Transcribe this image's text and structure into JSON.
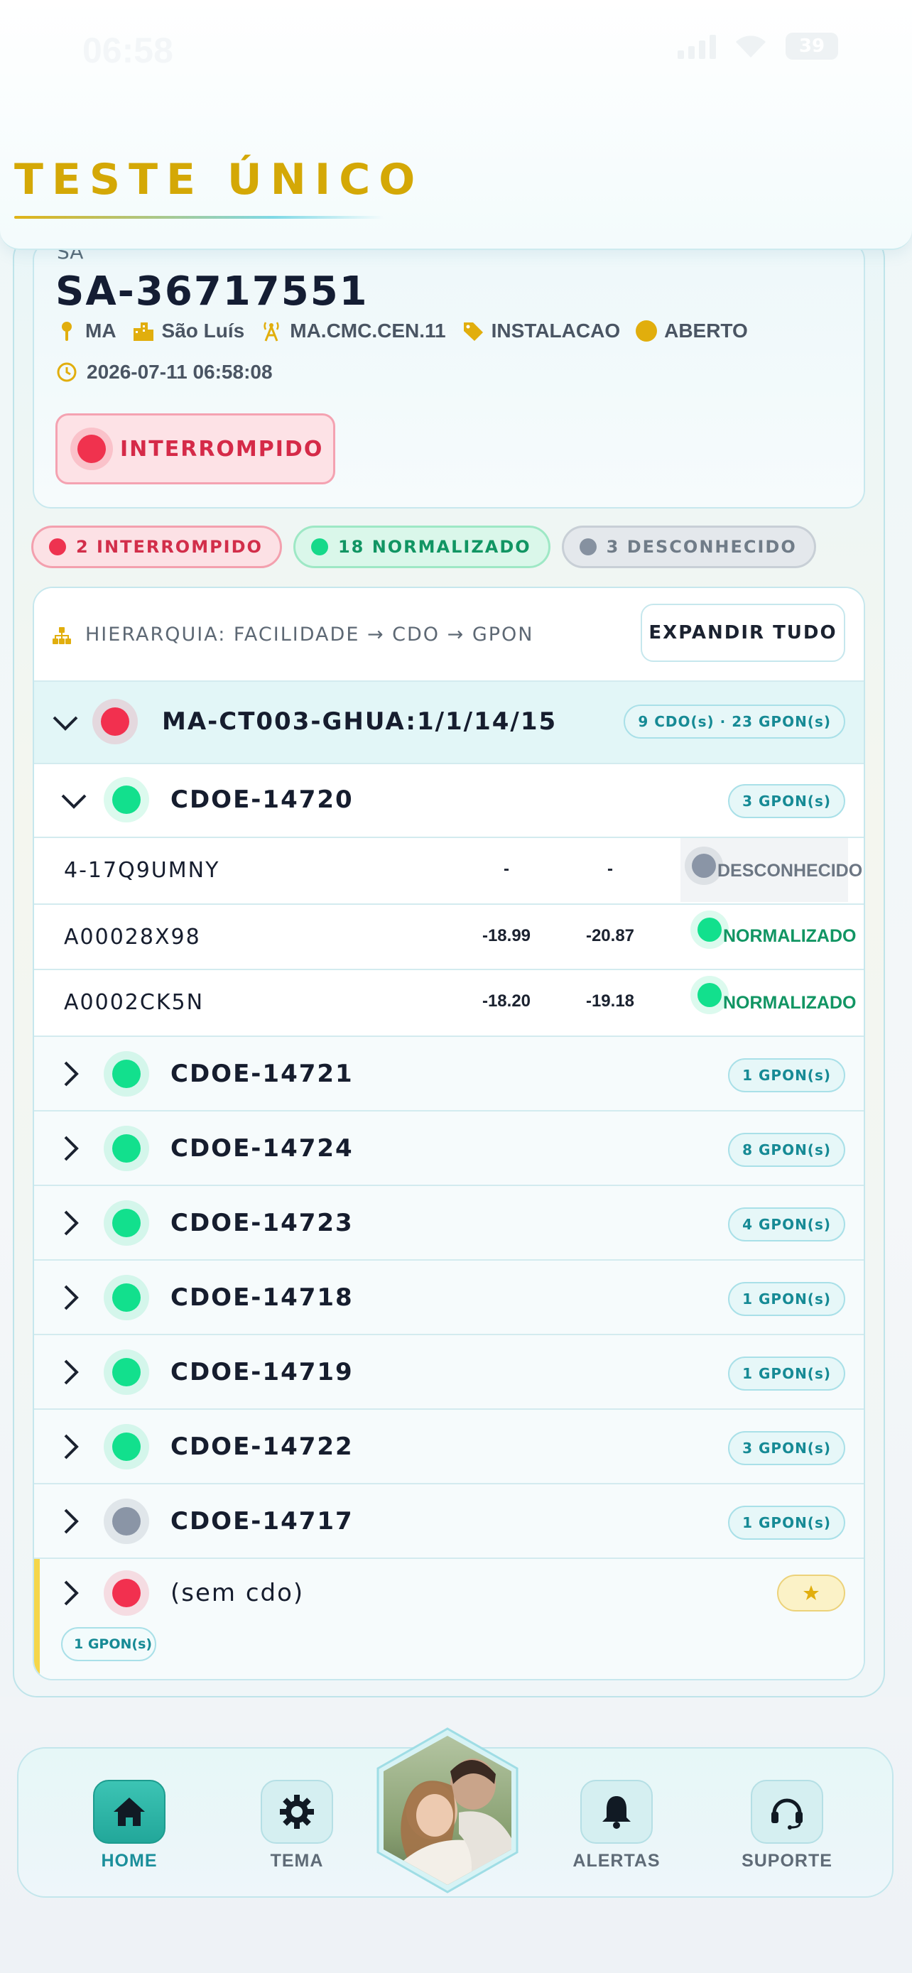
{
  "status_bar": {
    "time": "06:58",
    "battery": "39"
  },
  "header": {
    "title": "TESTE ÚNICO"
  },
  "sa_card": {
    "label": "SA",
    "id": "SA-36717551",
    "state": "MA",
    "city": "São Luís",
    "facility": "MA.CMC.CEN.11",
    "type": "INSTALACAO",
    "open_status": "ABERTO",
    "timestamp": "2026-07-11 06:58:08",
    "status": "INTERROMPIDO"
  },
  "summary": {
    "interrupted": "2 INTERROMPIDO",
    "normalized": "18 NORMALIZADO",
    "unknown": "3 DESCONHECIDO"
  },
  "tree": {
    "heading": "HIERARQUIA: FACILIDADE → CDO → GPON",
    "expand_label": "EXPANDIR TUDO",
    "facility": {
      "name": "MA-CT003-GHUA:1/1/14/15",
      "badge": "9 CDO(s) · 23 GPON(s)",
      "status": "red"
    },
    "open_cdo": {
      "name": "CDOE-14720",
      "badge": "3 GPON(s)",
      "status": "green"
    },
    "gpons": [
      {
        "code": "4-17Q9UMNY",
        "v1": "-",
        "v2": "-",
        "status": "DESCONHECIDO",
        "color": "gray"
      },
      {
        "code": "A00028X98",
        "v1": "-18.99",
        "v2": "-20.87",
        "status": "NORMALIZADO",
        "color": "green"
      },
      {
        "code": "A0002CK5N",
        "v1": "-18.20",
        "v2": "-19.18",
        "status": "NORMALIZADO",
        "color": "green"
      }
    ],
    "cdos": [
      {
        "name": "CDOE-14721",
        "badge": "1 GPON(s)",
        "status": "green"
      },
      {
        "name": "CDOE-14724",
        "badge": "8 GPON(s)",
        "status": "green"
      },
      {
        "name": "CDOE-14723",
        "badge": "4 GPON(s)",
        "status": "green"
      },
      {
        "name": "CDOE-14718",
        "badge": "1 GPON(s)",
        "status": "green"
      },
      {
        "name": "CDOE-14719",
        "badge": "1 GPON(s)",
        "status": "green"
      },
      {
        "name": "CDOE-14722",
        "badge": "3 GPON(s)",
        "status": "green"
      },
      {
        "name": "CDOE-14717",
        "badge": "1 GPON(s)",
        "status": "gray"
      }
    ],
    "no_cdo": {
      "name": "(sem cdo)",
      "count": "1 GPON(s)",
      "status": "red"
    }
  },
  "nav": {
    "home": "HOME",
    "theme": "TEMA",
    "alerts": "ALERTAS",
    "support": "SUPORTE"
  },
  "colors": {
    "accent": "#d4a806",
    "teal": "#22a79a",
    "red": "#f2304f",
    "green": "#12e08d",
    "gray": "#8a95a6"
  }
}
